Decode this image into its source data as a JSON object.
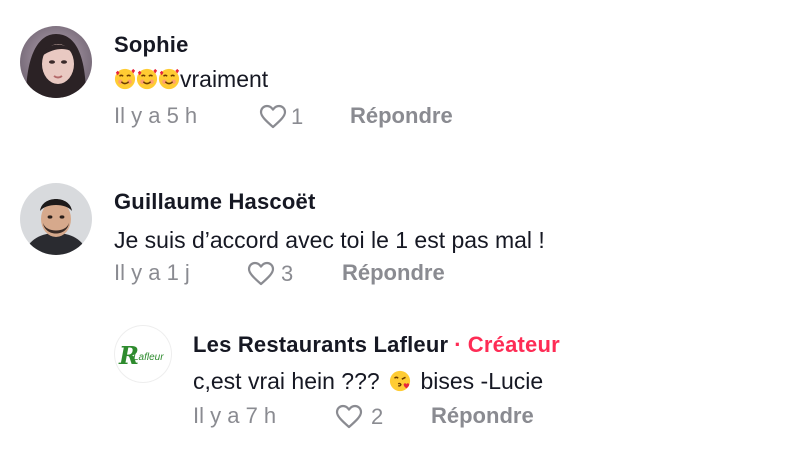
{
  "comments": [
    {
      "author": "Sophie",
      "text": "vraiment",
      "emojis": [
        "smiling-face-with-hearts",
        "smiling-face-with-hearts",
        "smiling-face-with-hearts"
      ],
      "time": "Il y a 5 h",
      "likes": "1",
      "reply_label": "Répondre"
    },
    {
      "author": "Guillaume Hascoët",
      "text": "Je suis d’accord avec toi le 1 est pas mal !",
      "time": "Il y a 1 j",
      "likes": "3",
      "reply_label": "Répondre"
    },
    {
      "author": "Les Restaurants Lafleur",
      "badge": "Créateur",
      "text_before": "c,est vrai hein ???",
      "emoji": "face-blowing-a-kiss",
      "text_after": "bises -Lucie",
      "time": "Il y a 7 h",
      "likes": "2",
      "reply_label": "Répondre",
      "logo_text": "Lafleur",
      "logo_letter": "R"
    }
  ],
  "colors": {
    "accent": "#fe2c55",
    "meta": "#8a8b91",
    "text": "#161823",
    "logo_green": "#2e8b2e"
  }
}
